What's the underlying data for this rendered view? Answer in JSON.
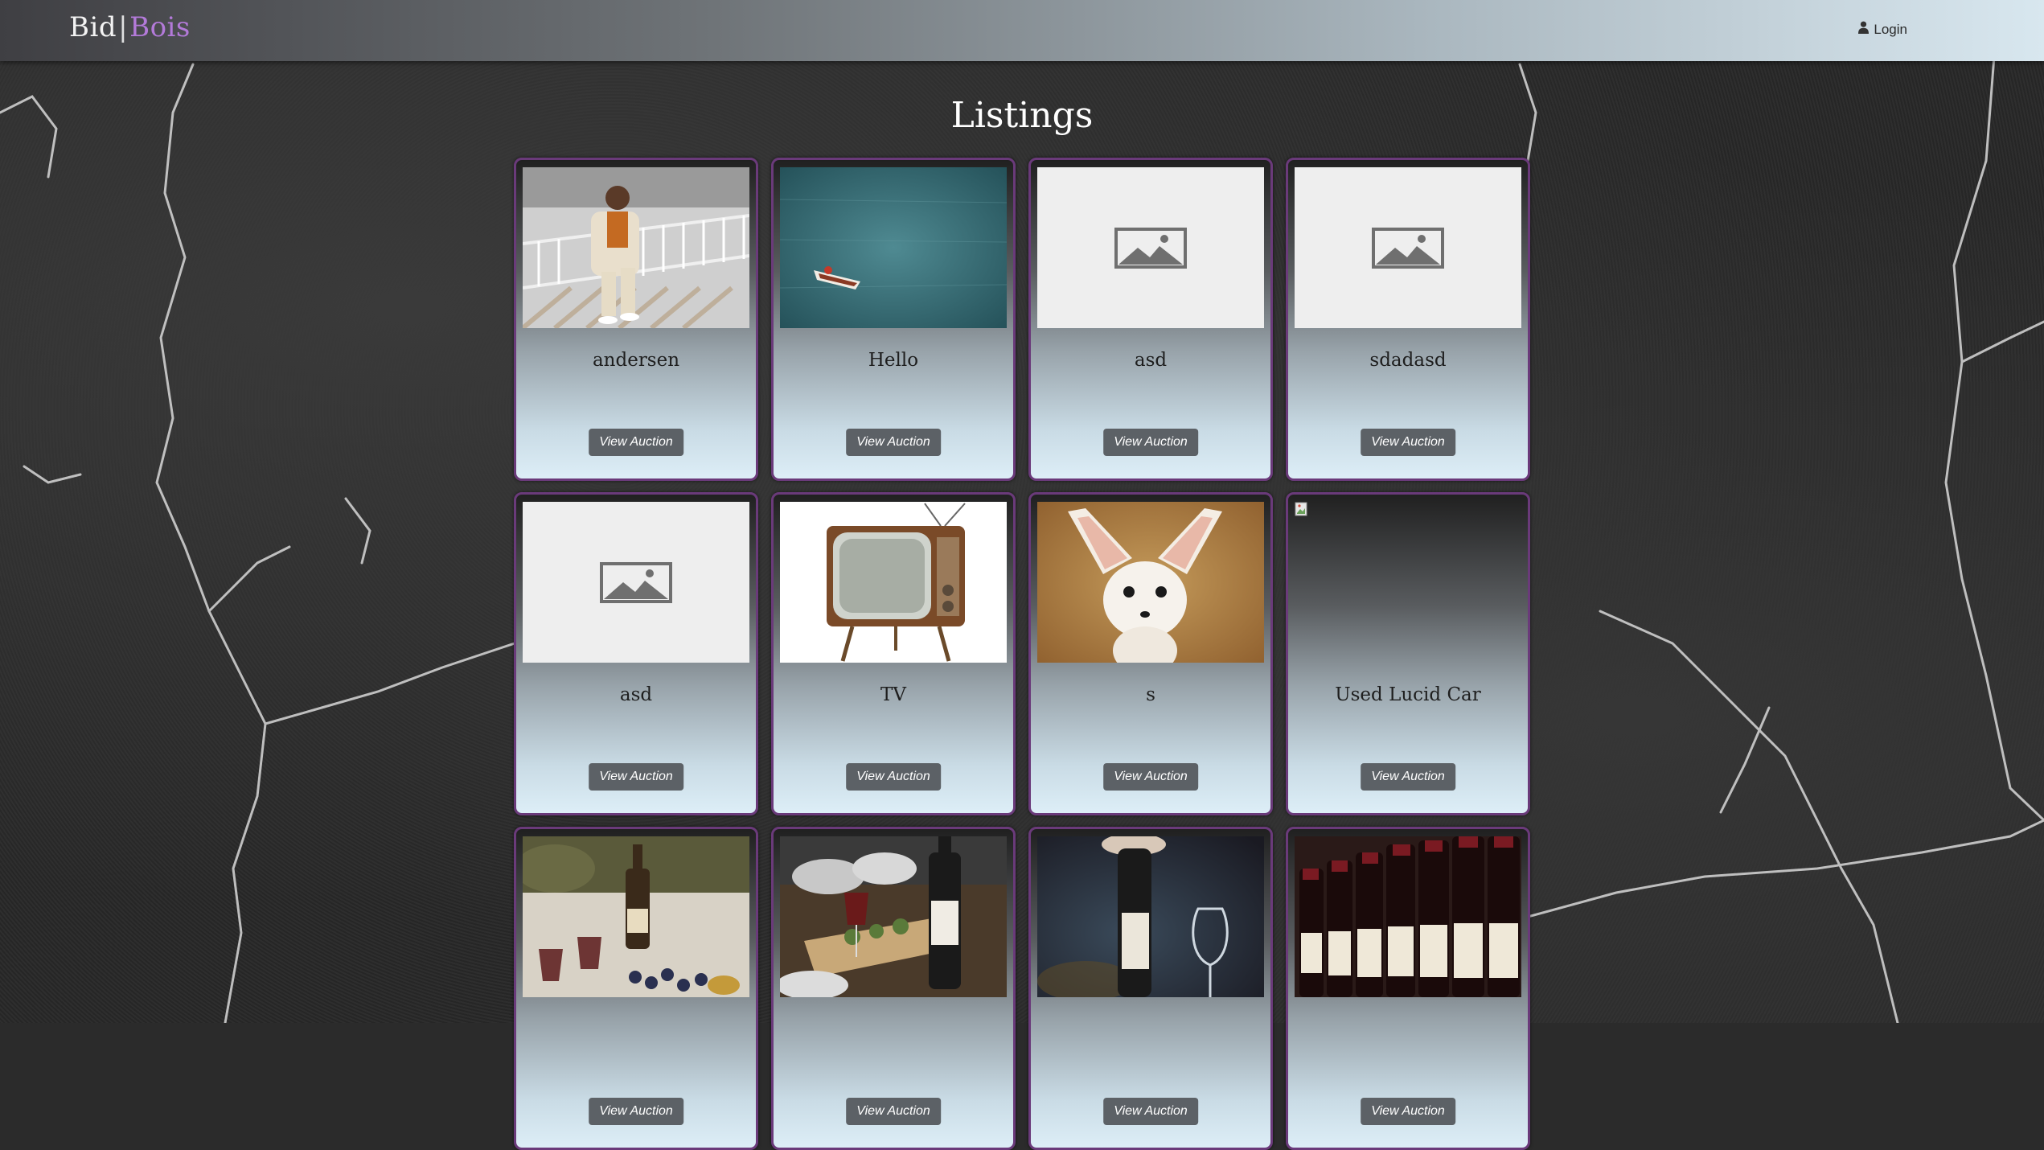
{
  "nav": {
    "brand_left": "Bid",
    "brand_sep": "|",
    "brand_right": "Bois",
    "login_label": "Login"
  },
  "page": {
    "title": "Listings"
  },
  "listings": [
    {
      "title": "andersen",
      "button": "View Auction",
      "image": "man-on-railing-photo"
    },
    {
      "title": "Hello",
      "button": "View Auction",
      "image": "boat-on-water-photo"
    },
    {
      "title": "asd",
      "button": "View Auction",
      "image": "placeholder-image-icon"
    },
    {
      "title": "sdadasd",
      "button": "View Auction",
      "image": "placeholder-image-icon"
    },
    {
      "title": "asd",
      "button": "View Auction",
      "image": "placeholder-image-icon"
    },
    {
      "title": "TV",
      "button": "View Auction",
      "image": "retro-tv-photo"
    },
    {
      "title": "s",
      "button": "View Auction",
      "image": "fennec-fox-photo"
    },
    {
      "title": "Used Lucid Car",
      "button": "View Auction",
      "image": "broken-image-icon"
    },
    {
      "title": "",
      "button": "View Auction",
      "image": "wine-picnic-photo"
    },
    {
      "title": "",
      "button": "View Auction",
      "image": "wine-dinner-table-photo"
    },
    {
      "title": "",
      "button": "View Auction",
      "image": "wine-bottle-pour-photo"
    },
    {
      "title": "",
      "button": "View Auction",
      "image": "wine-bottles-row-photo"
    }
  ],
  "colors": {
    "brand_accent": "#b37ad9",
    "card_border": "#6a3a7a",
    "button_bg": "#5c6166"
  }
}
